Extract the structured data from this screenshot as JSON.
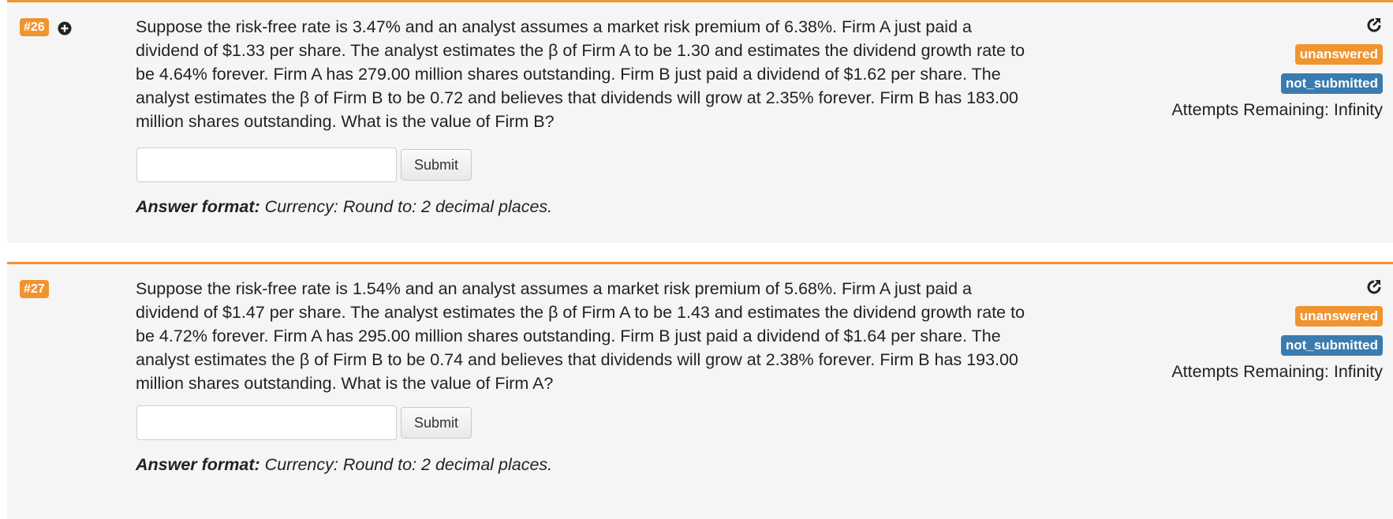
{
  "problems": [
    {
      "number": "#26",
      "has_plus_icon": true,
      "question": "Suppose the risk-free rate is 3.47% and an analyst assumes a market risk premium of 6.38%. Firm A just paid a dividend of $1.33 per share. The analyst estimates the β of Firm A to be 1.30 and estimates the dividend growth rate to be 4.64% forever. Firm A has 279.00 million shares outstanding. Firm B just paid a dividend of $1.62 per share. The analyst estimates the β of Firm B to be 0.72 and believes that dividends will grow at 2.35% forever. Firm B has 183.00 million shares outstanding. What is the value of Firm B?",
      "answer_value": "",
      "submit_label": "Submit",
      "answer_format_label": "Answer format:",
      "answer_format_text": " Currency: Round to: 2 decimal places.",
      "status_badge": "unanswered",
      "submission_badge": "not_submitted",
      "attempts": "Attempts Remaining: Infinity"
    },
    {
      "number": "#27",
      "has_plus_icon": false,
      "question": "Suppose the risk-free rate is 1.54% and an analyst assumes a market risk premium of 5.68%. Firm A just paid a dividend of $1.47 per share. The analyst estimates the β of Firm A to be 1.43 and estimates the dividend growth rate to be 4.72% forever. Firm A has 295.00 million shares outstanding. Firm B just paid a dividend of $1.64 per share. The analyst estimates the β of Firm B to be 0.74 and believes that dividends will grow at 2.38% forever. Firm B has 193.00 million shares outstanding. What is the value of Firm A?",
      "answer_value": "",
      "submit_label": "Submit",
      "answer_format_label": "Answer format:",
      "answer_format_text": " Currency: Round to: 2 decimal places.",
      "status_badge": "unanswered",
      "submission_badge": "not_submitted",
      "attempts": "Attempts Remaining: Infinity"
    }
  ],
  "icons": {
    "plus": "plus-circle-icon",
    "refresh": "external-refresh-icon"
  },
  "colors": {
    "accent_orange": "#f0942f",
    "badge_blue": "#3a7bb0",
    "panel_bg": "#f5f5f5"
  }
}
